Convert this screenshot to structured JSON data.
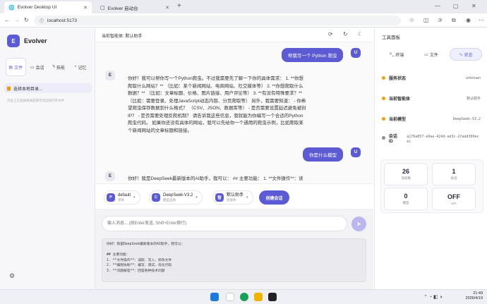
{
  "browser": {
    "tabs": [
      {
        "title": "Evolver Desktop UI",
        "active": true
      },
      {
        "title": "Evolver 启动台",
        "active": false
      }
    ],
    "url": "localhost:5173"
  },
  "sidebar": {
    "app_name": "Evolver",
    "logo_letter": "E",
    "tabs": [
      "文件",
      "会话",
      "技能",
      "记忆"
    ],
    "select_dir": "选择本地目录...",
    "hint": "点击上方选择目录后即可浏览和打开文件"
  },
  "header": {
    "current_agent": "当前智能体: 默认助手"
  },
  "chat": {
    "messages": [
      {
        "role": "user",
        "avatar": "U",
        "text": "帮我写一个 Python 爬虫"
      },
      {
        "role": "assistant",
        "avatar": "E",
        "lines": [
          "你好！我可以帮你写一个Python爬虫。不过我需要先了解一下你的具体需求： 1. **你想",
          "爬取什么网站？** （比如：某个新闻网站、电商网站、社交媒体等） 2. **你想爬取什么",
          "数据？** （比如：文章标题、价格、图片链接、用户评论等） 3. **有没有特殊要求？**",
          "（比如：需要登录、处理JavaScript动态内容、分页爬取等） 另外，我需要知道： - 你希",
          "望爬虫保存数据到什么格式？ （CSV、JSON、数据库等） - 是否需要设置延迟避免被封",
          "IP？ - 是否需要处理反爬机制？ 请告诉我这些信息，我就能为你编写一个合适的Python",
          "爬虫代码。 如果你还没有具体的网站，我可以先给你一个通用的爬虫示例，比如爬取某",
          "个新闻网站的文章标题和链接。"
        ]
      },
      {
        "role": "user",
        "avatar": "U",
        "text": "你是什么模型"
      },
      {
        "role": "assistant",
        "avatar": "E",
        "lines": [
          "你好！我是DeepSeek最新版本的AI助手，我可以： ## 主要功能： 1. **文件操作**：读"
        ]
      }
    ]
  },
  "controls": {
    "project": {
      "icon": "P",
      "name": "default",
      "label": "项目"
    },
    "model": {
      "icon": "C",
      "name": "DeepSeek-V3.2",
      "label": "模型选择"
    },
    "agent": {
      "icon": "智",
      "name": "默认助手",
      "label": "智能体"
    },
    "create_session": "创建会话"
  },
  "composer": {
    "placeholder": "输入消息... (按Enter发送, Shift+Enter换行)",
    "preview_lines": [
      "你好！我是DeepSeek最新版本的AI助手，我可以：",
      "",
      "## 主要功能：",
      "1. **文件操作**：读取、写入、修改文件",
      "2. **编程协助**：编写、调试、优化代码",
      "3. **问题解答**：回答各种技术问题"
    ]
  },
  "tools": {
    "title": "工具面板",
    "tabs": [
      "终端",
      "文件",
      "状态"
    ],
    "status": [
      {
        "label": "服务状态",
        "value": "unknown",
        "dot": "#f59e0b"
      },
      {
        "label": "当前智能体",
        "value": "默认助手",
        "dot": "#f59e0b"
      },
      {
        "label": "当前模型",
        "value": "DeepSeek-V3.2",
        "dot": "#f59e0b"
      },
      {
        "label": "会话 ID",
        "value": "a176a057-e0ae-424d-ad3c-2fadd300ecec",
        "dot": "#8b8ba8"
      }
    ],
    "cards": [
      {
        "num": "26",
        "label": "消息数"
      },
      {
        "num": "1",
        "label": "会话"
      },
      {
        "num": "0",
        "label": "模型"
      },
      {
        "num": "OFF",
        "label": "KPI"
      }
    ]
  },
  "taskbar": {
    "time": "21:49",
    "date": "2026/4/19"
  }
}
